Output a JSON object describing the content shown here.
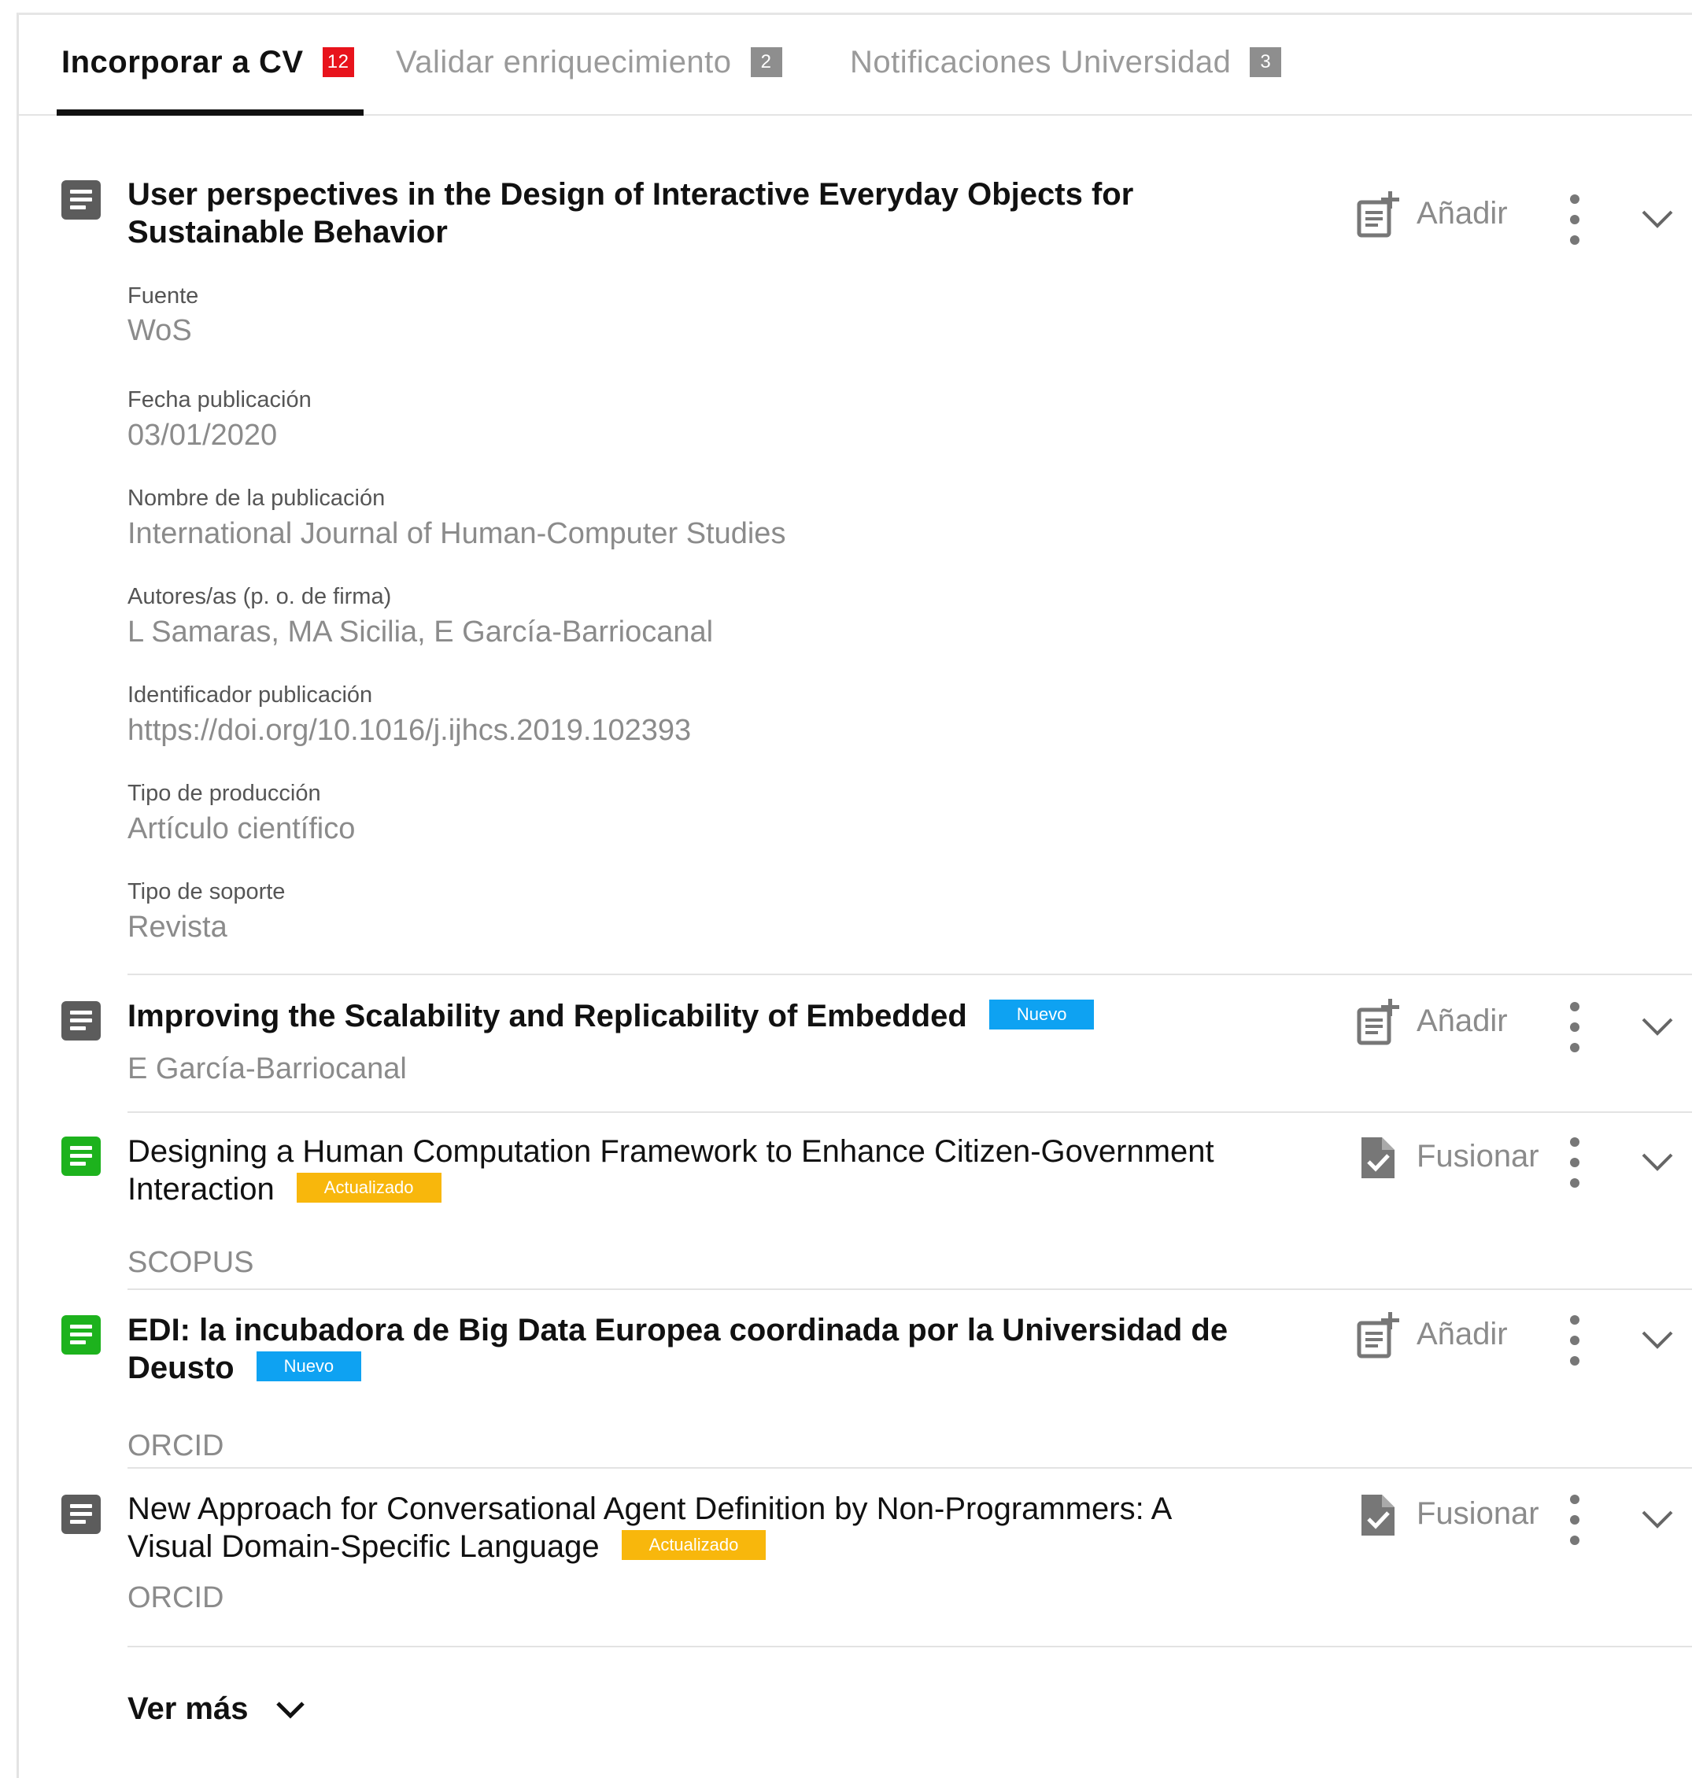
{
  "tabs": [
    {
      "label": "Incorporar a CV",
      "count": "12",
      "active": true
    },
    {
      "label": "Validar enriquecimiento",
      "count": "2",
      "active": false
    },
    {
      "label": "Notificaciones Universidad",
      "count": "3",
      "active": false
    }
  ],
  "colors": {
    "badge_active": "#e8131c",
    "badge_inactive": "#8e8e8e",
    "tag_new": "#0ea2f2",
    "tag_updated": "#f8b70c",
    "icon_grey": "#5c5c5c",
    "icon_green": "#1db21d"
  },
  "items": [
    {
      "icon": "document-icon",
      "title": "User perspectives in the Design of Interactive Everyday Objects for Sustainable Behavior",
      "action": {
        "label": "Añadir",
        "icon": "add-to-cv-icon"
      },
      "fields": [
        {
          "label": "Fuente",
          "value": "WoS"
        },
        {
          "label": "Fecha publicación",
          "value": "03/01/2020"
        },
        {
          "label": "Nombre de la publicación",
          "value": "International Journal of Human-Computer Studies"
        },
        {
          "label": "Autores/as (p. o. de firma)",
          "value": "L Samaras, MA Sicilia, E García-Barriocanal"
        },
        {
          "label": "Identificador publicación",
          "value": "https://doi.org/10.1016/j.ijhcs.2019.102393"
        },
        {
          "label": "Tipo de producción",
          "value": "Artículo científico"
        },
        {
          "label": "Tipo de soporte",
          "value": "Revista"
        }
      ]
    },
    {
      "icon": "document-icon",
      "title": "Improving the Scalability and Replicability of Embedded",
      "tag": "Nuevo",
      "subtext": "E García-Barriocanal",
      "action": {
        "label": "Añadir",
        "icon": "add-to-cv-icon"
      }
    },
    {
      "icon": "document-icon",
      "title_line1": "Designing a Human Computation Framework to Enhance Citizen-Government",
      "title_line2": "Interaction",
      "tag": "Actualizado",
      "subtext": "SCOPUS",
      "action": {
        "label": "Fusionar",
        "icon": "merge-document-icon"
      }
    },
    {
      "icon": "document-icon",
      "title_line1": "EDI: la incubadora de Big Data Europea coordinada por la Universidad de",
      "title_line2": "Deusto",
      "tag": "Nuevo",
      "subtext": "ORCID",
      "action": {
        "label": "Añadir",
        "icon": "add-to-cv-icon"
      }
    },
    {
      "icon": "document-icon",
      "title_line1": "New Approach for Conversational Agent Definition by Non-Programmers: A",
      "title_line2": "Visual Domain-Specific Language",
      "tag": "Actualizado",
      "subtext": "ORCID",
      "action": {
        "label": "Fusionar",
        "icon": "merge-document-icon"
      }
    }
  ],
  "show_more": "Ver más"
}
